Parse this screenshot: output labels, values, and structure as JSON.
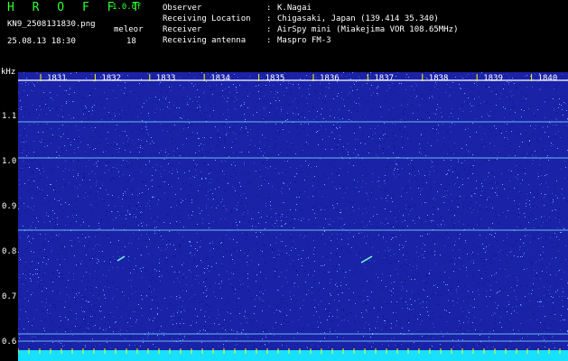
{
  "header": {
    "app_name": "H R O F F T",
    "version": "1.0.0f",
    "file_name": "KN9_2508131830.png",
    "mode_label": "meleor",
    "timestamp": "25.08.13 18:30",
    "count_value": "18"
  },
  "meta": [
    {
      "key": "Observer",
      "sep": ":",
      "value": "K.Nagai"
    },
    {
      "key": "Receiving Location",
      "sep": ":",
      "value": "Chigasaki, Japan (139.414 35.340)"
    },
    {
      "key": "Receiver",
      "sep": ":",
      "value": "AirSpy mini (Miakejima VOR 108.65MHz)"
    },
    {
      "key": "Receiving antenna",
      "sep": ":",
      "value": "Maspro FM-3"
    }
  ],
  "axis": {
    "unit": "kHz",
    "y_ticks": [
      "1.1",
      "1.0",
      "0.9",
      "0.8",
      "0.7",
      "0.6"
    ],
    "x_ticks": [
      "1831",
      "1832",
      "1833",
      "1834",
      "1835",
      "1836",
      "1837",
      "1838",
      "1839",
      "1840"
    ]
  },
  "colors": {
    "background": "#000000",
    "noise_dark": "#1a22a8",
    "noise_light": "#6aa8ff",
    "line": "#7fe0ff",
    "bottom_band": "#18e0ff",
    "tick": "#ffff00"
  }
}
